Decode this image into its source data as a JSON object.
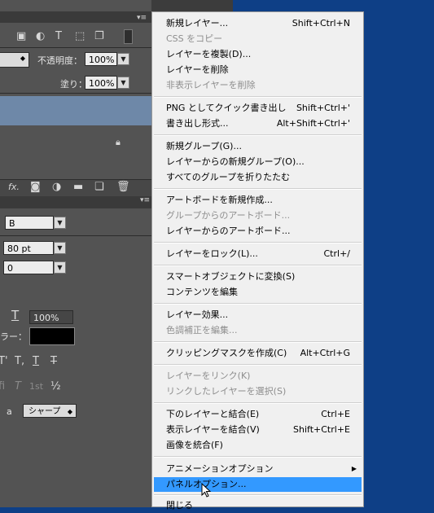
{
  "panel": {
    "opacity_label": "不透明度：",
    "opacity_value": "100%",
    "fill_label": "塗り：",
    "fill_value": "100%",
    "font_style_value": "B",
    "font_size_value": "80 pt",
    "leading_value": "0",
    "vscale_value": "100%",
    "color_label": "ラー：",
    "antialias_value": "シャープ",
    "aa_label": "a",
    "glyph_fraction": "½",
    "glyph_ordinal": "1st",
    "layers_bottom_fx": "fx."
  },
  "menu": {
    "items": [
      {
        "label": "新規レイヤー...",
        "shortcut": "Shift+Ctrl+N",
        "disabled": false
      },
      {
        "label": "CSS をコピー",
        "shortcut": "",
        "disabled": true
      },
      {
        "label": "レイヤーを複製(D)...",
        "shortcut": "",
        "disabled": false
      },
      {
        "label": "レイヤーを削除",
        "shortcut": "",
        "disabled": false
      },
      {
        "label": "非表示レイヤーを削除",
        "shortcut": "",
        "disabled": true
      },
      {
        "label": "PNG としてクイック書き出し",
        "shortcut": "Shift+Ctrl+'",
        "disabled": false
      },
      {
        "label": "書き出し形式...",
        "shortcut": "Alt+Shift+Ctrl+'",
        "disabled": false
      },
      {
        "label": "新規グループ(G)...",
        "shortcut": "",
        "disabled": false
      },
      {
        "label": "レイヤーからの新規グループ(O)...",
        "shortcut": "",
        "disabled": false
      },
      {
        "label": "すべてのグループを折りたたむ",
        "shortcut": "",
        "disabled": false
      },
      {
        "label": "アートボードを新規作成...",
        "shortcut": "",
        "disabled": false
      },
      {
        "label": "グループからのアートボード...",
        "shortcut": "",
        "disabled": true
      },
      {
        "label": "レイヤーからのアートボード...",
        "shortcut": "",
        "disabled": false
      },
      {
        "label": "レイヤーをロック(L)...",
        "shortcut": "Ctrl+/",
        "disabled": false
      },
      {
        "label": "スマートオブジェクトに変換(S)",
        "shortcut": "",
        "disabled": false
      },
      {
        "label": "コンテンツを編集",
        "shortcut": "",
        "disabled": false
      },
      {
        "label": "レイヤー効果...",
        "shortcut": "",
        "disabled": false
      },
      {
        "label": "色調補正を編集...",
        "shortcut": "",
        "disabled": true
      },
      {
        "label": "クリッピングマスクを作成(C)",
        "shortcut": "Alt+Ctrl+G",
        "disabled": false
      },
      {
        "label": "レイヤーをリンク(K)",
        "shortcut": "",
        "disabled": true
      },
      {
        "label": "リンクしたレイヤーを選択(S)",
        "shortcut": "",
        "disabled": true
      },
      {
        "label": "下のレイヤーと結合(E)",
        "shortcut": "Ctrl+E",
        "disabled": false
      },
      {
        "label": "表示レイヤーを結合(V)",
        "shortcut": "Shift+Ctrl+E",
        "disabled": false
      },
      {
        "label": "画像を統合(F)",
        "shortcut": "",
        "disabled": false
      },
      {
        "label": "アニメーションオプション",
        "shortcut": "",
        "disabled": false
      },
      {
        "label": "パネルオプション...",
        "shortcut": "",
        "disabled": false
      },
      {
        "label": "閉じる",
        "shortcut": "",
        "disabled": false
      }
    ]
  }
}
